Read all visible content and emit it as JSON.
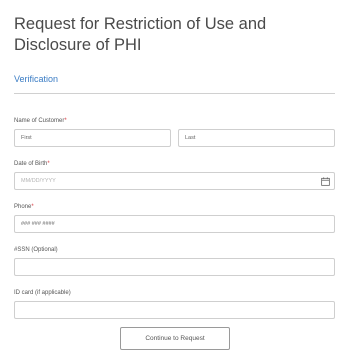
{
  "form": {
    "title": "Request for Restriction of Use and Disclosure of PHI",
    "section": "Verification"
  },
  "name": {
    "label": "Name of Customer",
    "required_mark": "*",
    "first_placeholder": "First",
    "last_placeholder": "Last"
  },
  "dob": {
    "label": "Date of Birth",
    "required_mark": "*",
    "placeholder": "MM/DD/YYYY",
    "icon": "calendar-icon"
  },
  "phone": {
    "label": "Phone",
    "required_mark": "*",
    "placeholder": "### ### ####"
  },
  "ssn": {
    "label": "#SSN (Optional)",
    "value": ""
  },
  "idcard": {
    "label": "ID card (if applicable)",
    "value": ""
  },
  "actions": {
    "continue_label": "Continue to Request"
  },
  "colors": {
    "accent": "#3a7cc4",
    "required": "#d9363e"
  }
}
